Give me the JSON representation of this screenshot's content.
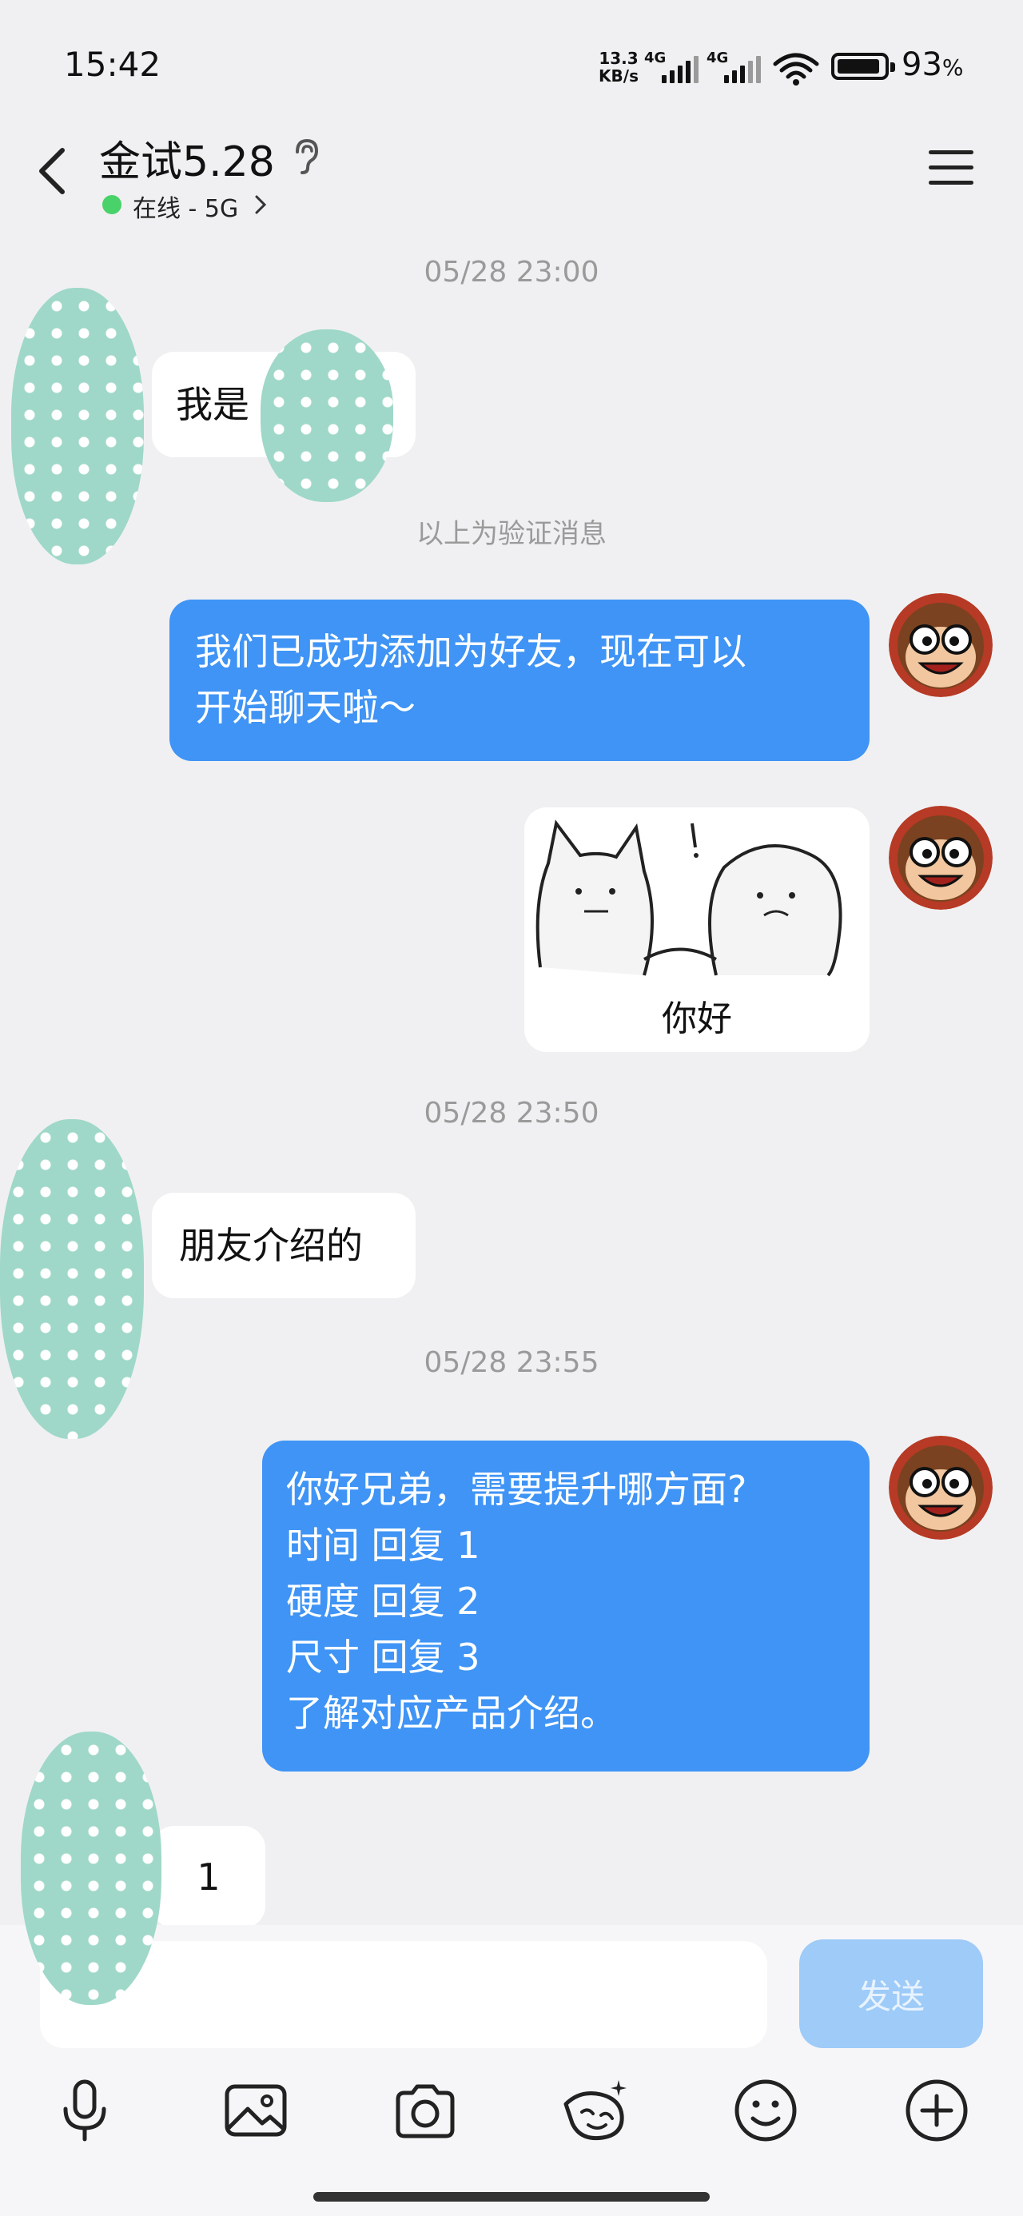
{
  "status_bar": {
    "time": "15:42",
    "net_speed_value": "13.3",
    "net_speed_unit": "KB/s",
    "signal1_type": "4G",
    "signal2_type": "4G",
    "battery_percent": "93",
    "battery_unit": "%"
  },
  "header": {
    "title": "金试5.28",
    "status": "在线 - 5G",
    "status_color": "#49d26a"
  },
  "messages": {
    "ts1": "05/28 23:00",
    "m1_text": "我是",
    "system_notice": "以上为验证消息",
    "m2_line1": "我们已成功添加为好友，现在可以",
    "m2_line2": "开始聊天啦～",
    "sticker_caption": "你好",
    "ts2": "05/28 23:50",
    "m4_text": "朋友介绍的",
    "ts3": "05/28 23:55",
    "m5_lines": [
      "你好兄弟，需要提升哪方面?",
      "时间 回复 1",
      "硬度 回复 2",
      "尺寸 回复 3",
      "了解对应产品介绍。"
    ],
    "m6_text": "1"
  },
  "input_bar": {
    "send_label": "发送",
    "tools": [
      "microphone-icon",
      "image-icon",
      "camera-icon",
      "sticker-icon",
      "emoji-icon",
      "plus-icon"
    ]
  },
  "colors": {
    "outgoing_bubble": "#3f94f5",
    "incoming_bubble": "#ffffff",
    "send_button": "#9ecbf8",
    "background": "#f0f0f2"
  }
}
